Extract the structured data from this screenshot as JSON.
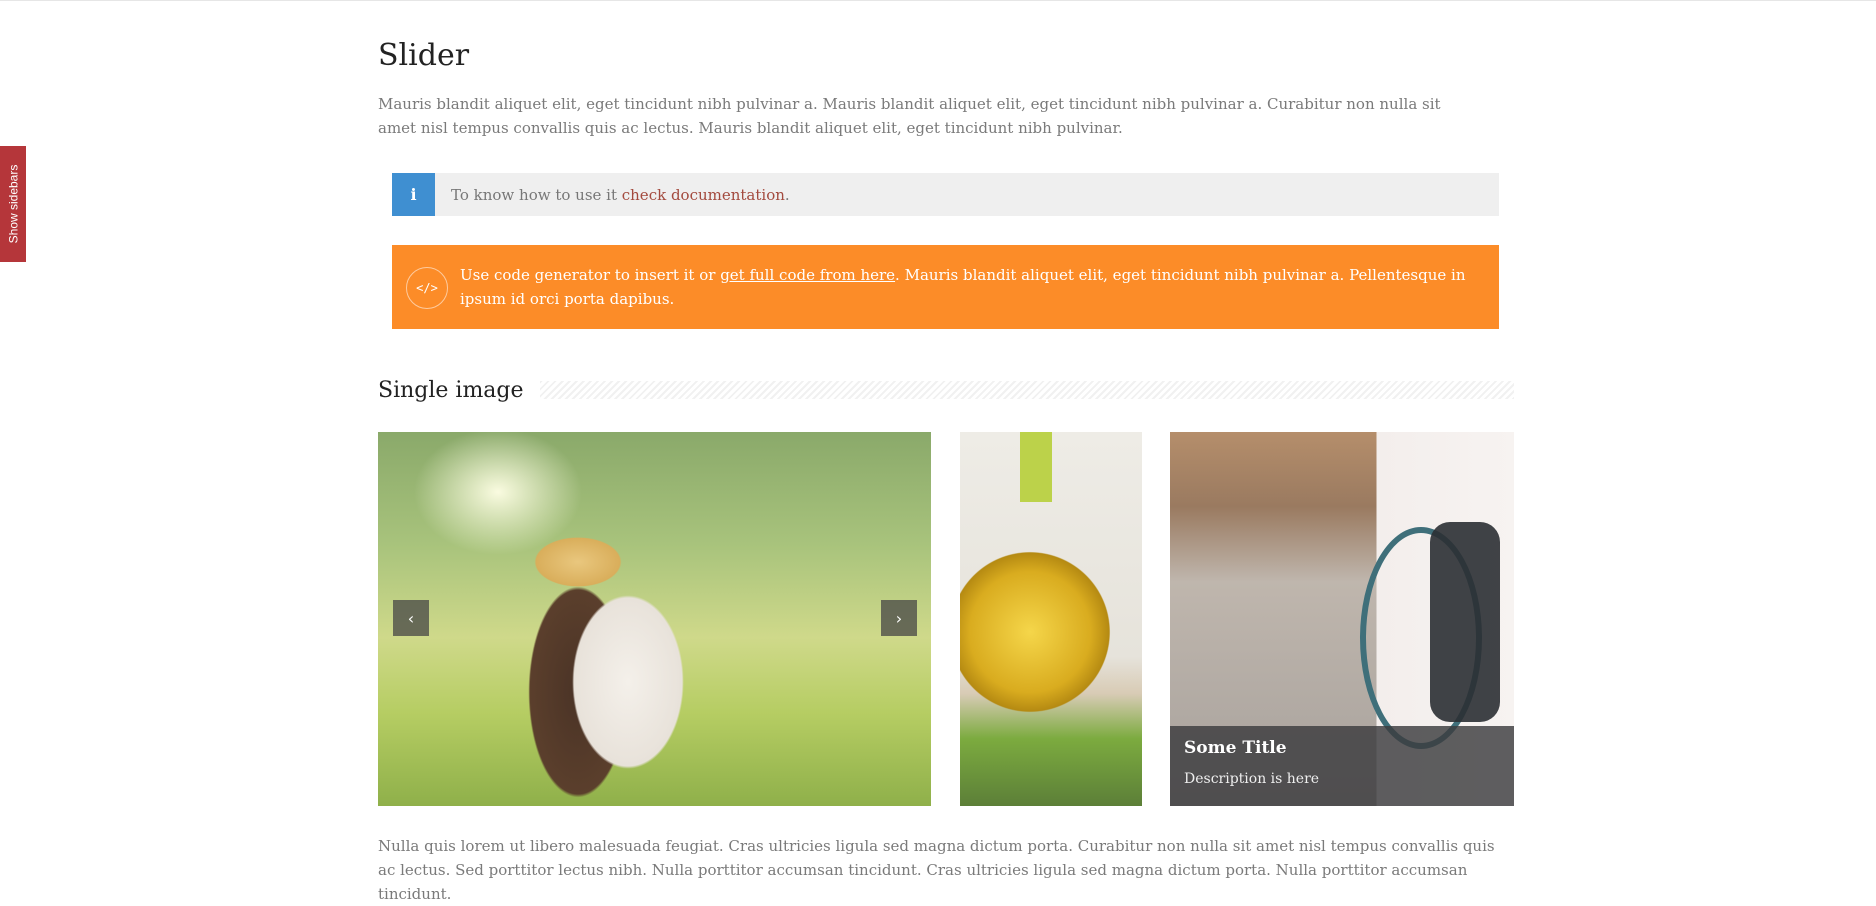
{
  "sidebar_toggle": {
    "label": "Show sidebars",
    "color": "#b5363a"
  },
  "page": {
    "title": "Slider",
    "intro": "Mauris blandit aliquet elit, eget tincidunt nibh pulvinar a. Mauris blandit aliquet elit, eget tincidunt nibh pulvinar a. Curabitur non nulla sit amet nisl tempus convallis quis ac lectus. Mauris blandit aliquet elit, eget tincidunt nibh pulvinar."
  },
  "info_box": {
    "icon": "info-icon",
    "text_before": "To know how to use it ",
    "link_text": "check documentation",
    "text_after": ".",
    "icon_color": "#3f8fd1"
  },
  "code_box": {
    "icon": "code-icon",
    "icon_glyph": "</>",
    "text_before": "Use code generator to insert it or ",
    "link_text": "get full code from here",
    "text_after": ". Mauris blandit aliquet elit, eget tincidunt nibh pulvinar a. Pellentesque in ipsum id orci porta dapibus.",
    "background_color": "#fc8c28"
  },
  "section": {
    "heading": "Single image"
  },
  "slider": {
    "prev_icon": "chevron-left-icon",
    "next_icon": "chevron-right-icon",
    "prev_glyph": "‹",
    "next_glyph": "›"
  },
  "caption": {
    "title": "Some Title",
    "description": "Description is here"
  },
  "outro": "Nulla quis lorem ut libero malesuada feugiat. Cras ultricies ligula sed magna dictum porta. Curabitur non nulla sit amet nisl tempus convallis quis ac lectus. Sed porttitor lectus nibh. Nulla porttitor accumsan tincidunt. Cras ultricies ligula sed magna dictum porta. Nulla porttitor accumsan tincidunt."
}
